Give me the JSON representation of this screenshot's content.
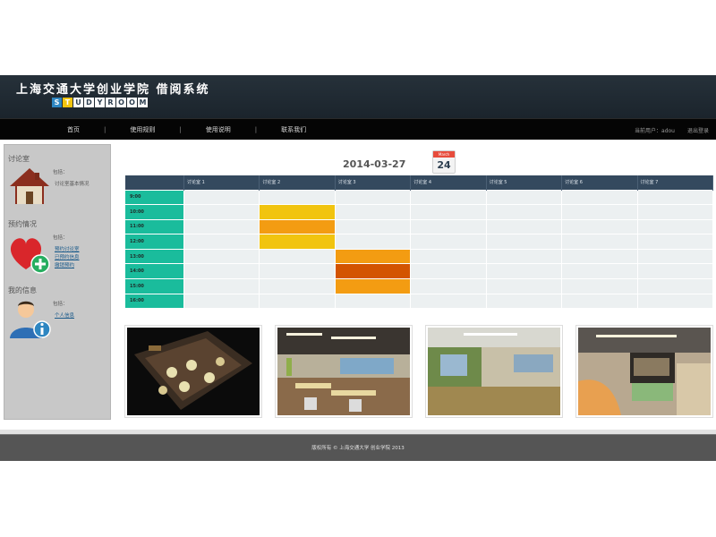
{
  "header": {
    "title": "上海交通大学创业学院 借阅系统",
    "logo_letters": [
      "S",
      "T",
      "U",
      "D",
      "Y",
      "R",
      "O",
      "O",
      "M"
    ],
    "logo_colors": [
      "#2e86c1",
      "#f1c40f",
      "#ffffff",
      "#ffffff",
      "#ffffff",
      "#ffffff",
      "#ffffff",
      "#ffffff",
      "#ffffff"
    ]
  },
  "nav": {
    "items": [
      "首页",
      "使用规则",
      "使用说明",
      "联系我们"
    ],
    "separator": "|",
    "user_text": "当前用户：adou",
    "logout": "退出登录"
  },
  "sidebar": {
    "sections": [
      {
        "title": "讨论室",
        "icon": "house-icon",
        "label": "包括：",
        "lines": [
          "讨论室基本情况"
        ],
        "links": []
      },
      {
        "title": "预约情况",
        "icon": "heart-add-icon",
        "label": "包括：",
        "lines": [],
        "links": [
          "预约讨论室",
          "已预约信息",
          "撤销预约"
        ]
      },
      {
        "title": "我的信息",
        "icon": "user-info-icon",
        "label": "包括：",
        "lines": [],
        "links": [
          "个人信息"
        ]
      }
    ]
  },
  "main": {
    "date": "2014-03-27",
    "calendar": {
      "month": "March",
      "day": "24"
    },
    "columns": [
      "讨论室 1",
      "讨论室 2",
      "讨论室 3",
      "讨论室 4",
      "讨论室 5",
      "讨论室 6",
      "讨论室 7"
    ],
    "times": [
      "9:00",
      "10:00",
      "11:00",
      "12:00",
      "13:00",
      "14:00",
      "15:00",
      "16:00"
    ],
    "bookings": [
      {
        "row": 1,
        "col": 1,
        "color": "#f1c40f"
      },
      {
        "row": 2,
        "col": 1,
        "color": "#f39c12"
      },
      {
        "row": 3,
        "col": 1,
        "color": "#f1c40f"
      },
      {
        "row": 4,
        "col": 2,
        "color": "#f39c12"
      },
      {
        "row": 5,
        "col": 2,
        "color": "#d35400"
      },
      {
        "row": 6,
        "col": 2,
        "color": "#f39c12"
      }
    ],
    "photos": [
      "room-photo-1",
      "room-photo-2",
      "room-photo-3",
      "room-photo-4"
    ]
  },
  "footer": {
    "text": "版权所有 © 上海交通大学 创业学院 2013"
  },
  "colors": {
    "time_cell": "#1abc9c",
    "empty_cell": "#ecf0f1",
    "header_cell": "#34495e"
  }
}
